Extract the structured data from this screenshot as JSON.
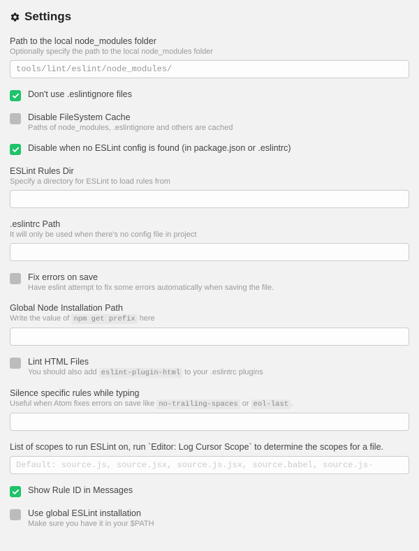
{
  "title": "Settings",
  "settings": {
    "nodePath": {
      "label": "Path to the local node_modules folder",
      "sub": "Optionally specify the path to the local node_modules folder",
      "value": "tools/lint/eslint/node_modules/"
    },
    "ignoreFiles": {
      "label": "Don't use .eslintignore files",
      "checked": true
    },
    "disableCache": {
      "label": "Disable FileSystem Cache",
      "sub": "Paths of node_modules, .eslintignore and others are cached",
      "checked": false
    },
    "disableNoConfig": {
      "label": "Disable when no ESLint config is found (in package.json or .eslintrc)",
      "checked": true
    },
    "rulesDir": {
      "label": "ESLint Rules Dir",
      "sub": "Specify a directory for ESLint to load rules from",
      "value": ""
    },
    "eslintrcPath": {
      "label": ".eslintrc Path",
      "sub": "It will only be used when there's no config file in project",
      "value": ""
    },
    "fixOnSave": {
      "label": "Fix errors on save",
      "sub": "Have eslint attempt to fix some errors automatically when saving the file.",
      "checked": false
    },
    "globalNode": {
      "label": "Global Node Installation Path",
      "subPre": "Write the value of ",
      "subCode": "npm get prefix",
      "subPost": " here",
      "value": ""
    },
    "lintHtml": {
      "label": "Lint HTML Files",
      "subPre": "You should also add ",
      "subCode": "eslint-plugin-html",
      "subPost": " to your .eslintrc plugins",
      "checked": false
    },
    "silenceRules": {
      "label": "Silence specific rules while typing",
      "subPre": "Useful when Atom fixes errors on save like ",
      "subCode1": "no-trailing-spaces",
      "subMid": " or ",
      "subCode2": "eol-last",
      "subPost": ".",
      "value": ""
    },
    "scopes": {
      "label": "List of scopes to run ESLint on, run `Editor: Log Cursor Scope` to determine the scopes for a file.",
      "placeholder": "Default: source.js, source.jsx, source.js.jsx, source.babel, source.js-"
    },
    "showRuleId": {
      "label": "Show Rule ID in Messages",
      "checked": true
    },
    "useGlobal": {
      "label": "Use global ESLint installation",
      "sub": "Make sure you have it in your $PATH",
      "checked": false
    }
  }
}
